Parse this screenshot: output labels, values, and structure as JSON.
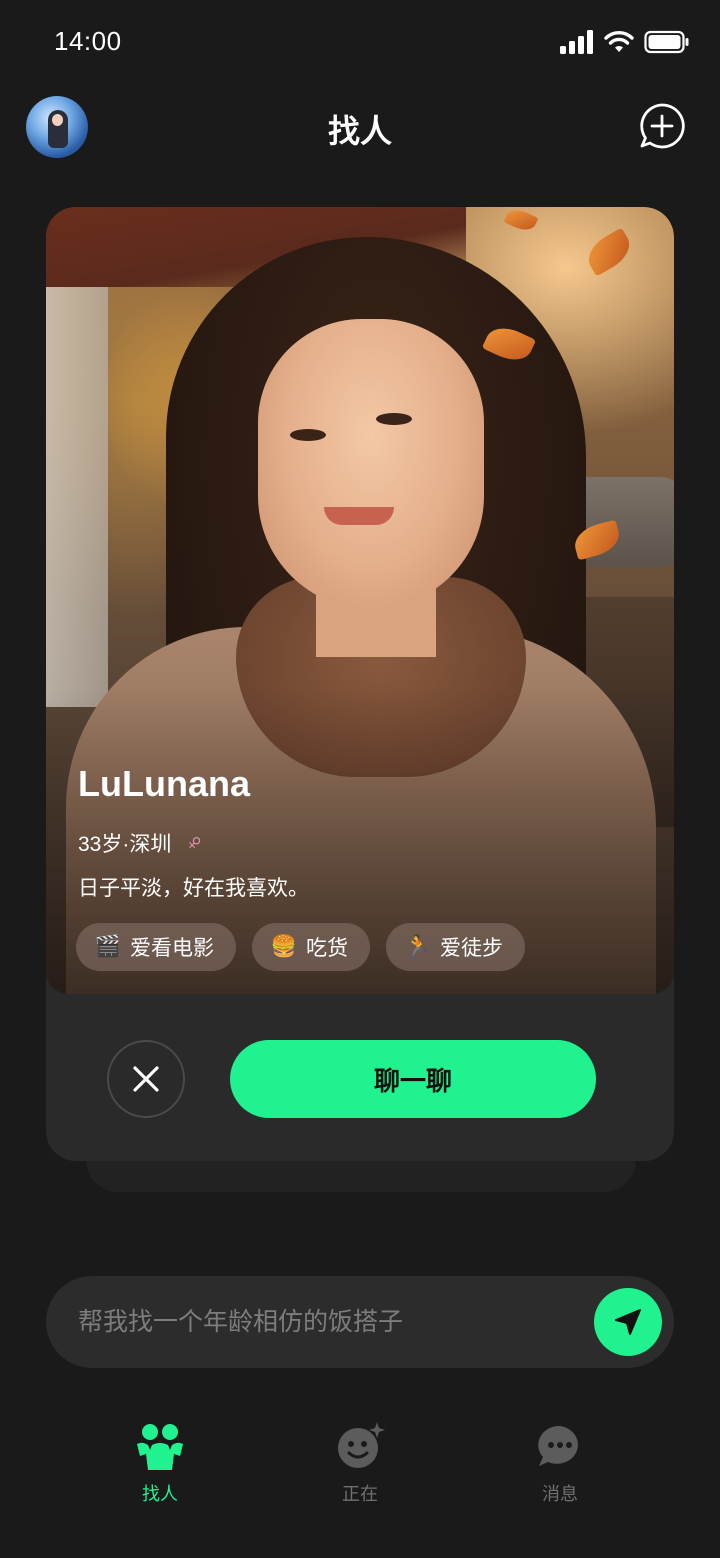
{
  "status_bar": {
    "time": "14:00"
  },
  "header": {
    "title": "找人"
  },
  "profile": {
    "name": "LuLunana",
    "age_city": "33岁·深圳",
    "gender_symbol": "♀",
    "bio": "日子平淡，好在我喜欢。",
    "tags": [
      {
        "emoji": "🎬",
        "label": "爱看电影"
      },
      {
        "emoji": "🍔",
        "label": "吃货"
      },
      {
        "emoji": "🏃",
        "label": "爱徒步"
      }
    ]
  },
  "actions": {
    "chat_label": "聊一聊"
  },
  "search": {
    "placeholder": "帮我找一个年龄相仿的饭搭子"
  },
  "tabs": [
    {
      "label": "找人",
      "icon": "people-icon",
      "active": true
    },
    {
      "label": "正在",
      "icon": "smiley-sparkle-icon",
      "active": false
    },
    {
      "label": "消息",
      "icon": "chat-bubble-icon",
      "active": false
    }
  ],
  "colors": {
    "accent": "#1ff28e",
    "background": "#1a1a1a",
    "card": "#2a2a2a",
    "gender": "#f29ac0"
  }
}
